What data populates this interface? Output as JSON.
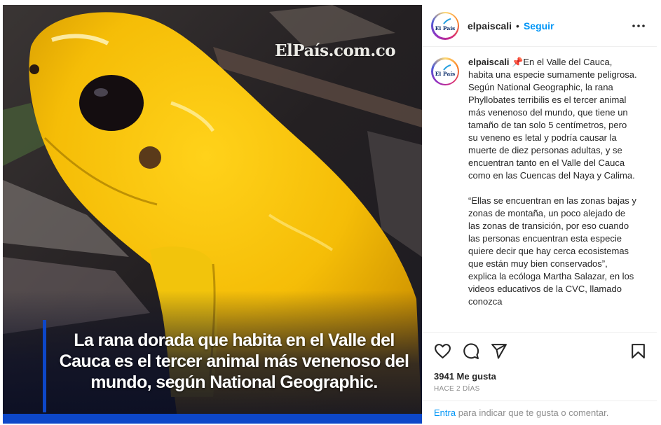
{
  "post": {
    "image": {
      "watermark": "ElPaís.com.co",
      "caption": "La rana dorada que habita en el Valle del Cauca es el tercer animal más venenoso del mundo, según National Geographic.",
      "accent_color": "#0d47c8"
    },
    "header": {
      "avatar_text": "El País",
      "username": "elpaiscali",
      "separator": "•",
      "follow_label": "Seguir",
      "more_icon": "more-horizontal-icon"
    },
    "comments": {
      "username": "elpaiscali",
      "pin": "📌",
      "paragraphs": [
        "En el Valle del Cauca, habita una especie sumamente peligrosa. Según National Geographic, la rana Phyllobates terribilis es el tercer animal más venenoso del mundo, que tiene un tamaño de tan solo 5 centímetros, pero su veneno es letal y podría causar la muerte de diez personas adultas, y se encuentran tanto en el Valle del Cauca como en las Cuencas del Naya y Calima.",
        "“Ellas se encuentran en las zonas bajas y zonas de montaña, un poco alejado de las zonas de transición, por eso cuando las personas encuentran esta especie quiere decir que hay cerca ecosistemas que están muy bien conservados”, explica la ecóloga Martha Salazar, en los videos educativos de la CVC, llamado conozca"
      ]
    },
    "actions": {
      "icons": [
        "heart-icon",
        "comment-icon",
        "share-icon",
        "bookmark-icon"
      ]
    },
    "likes": "3941 Me gusta",
    "date": "HACE 2 DÍAS",
    "comment_prompt": {
      "login_label": "Entra",
      "text": " para indicar que te gusta o comentar."
    }
  }
}
